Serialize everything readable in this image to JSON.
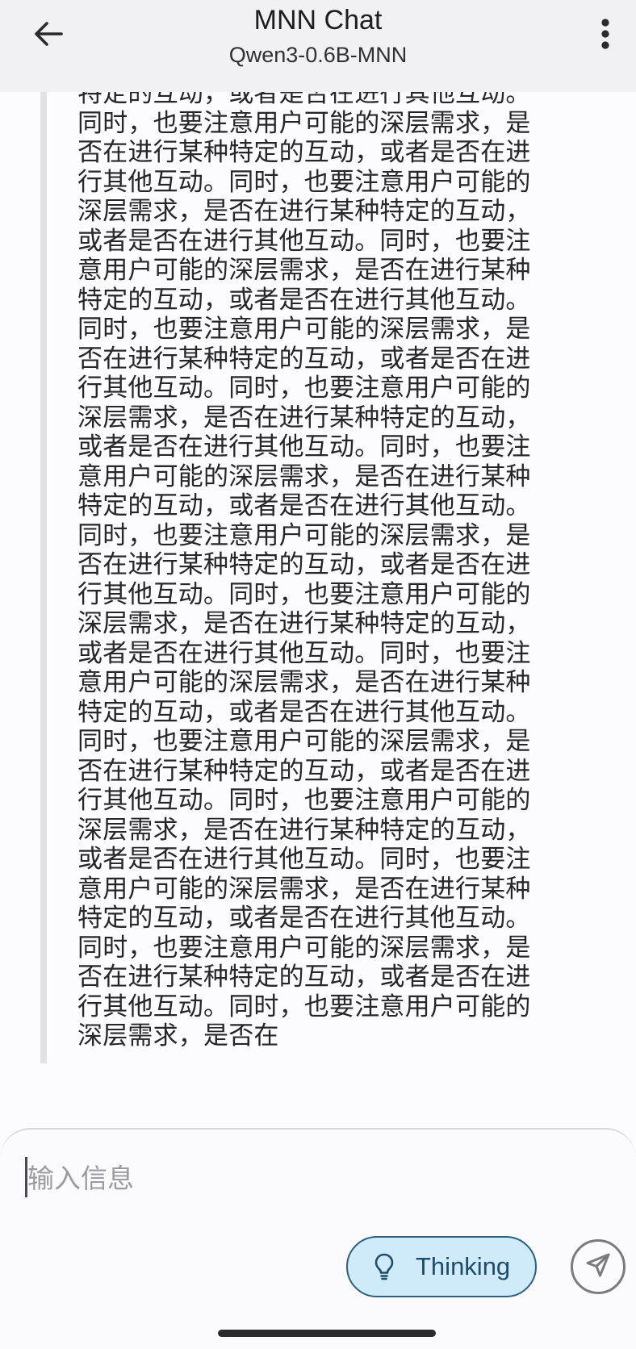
{
  "header": {
    "title": "MNN Chat",
    "subtitle": "Qwen3-0.6B-MNN",
    "back_icon": "arrow-left-icon",
    "menu_icon": "more-vertical-icon"
  },
  "message": {
    "lines": [
      "特定的互动，或者是否在进行其他互动。",
      "同时，也要注意用户可能的深层需求，是",
      "否在进行某种特定的互动，或者是否在进",
      "行其他互动。同时，也要注意用户可能的",
      "深层需求，是否在进行某种特定的互动，",
      "或者是否在进行其他互动。同时，也要注",
      "意用户可能的深层需求，是否在进行某种",
      "特定的互动，或者是否在进行其他互动。",
      "同时，也要注意用户可能的深层需求，是",
      "否在进行某种特定的互动，或者是否在进",
      "行其他互动。同时，也要注意用户可能的",
      "深层需求，是否在进行某种特定的互动，",
      "或者是否在进行其他互动。同时，也要注",
      "意用户可能的深层需求，是否在进行某种",
      "特定的互动，或者是否在进行其他互动。",
      "同时，也要注意用户可能的深层需求，是",
      "否在进行某种特定的互动，或者是否在进",
      "行其他互动。同时，也要注意用户可能的",
      "深层需求，是否在进行某种特定的互动，",
      "或者是否在进行其他互动。同时，也要注",
      "意用户可能的深层需求，是否在进行某种",
      "特定的互动，或者是否在进行其他互动。",
      "同时，也要注意用户可能的深层需求，是",
      "否在进行某种特定的互动，或者是否在进",
      "行其他互动。同时，也要注意用户可能的",
      "深层需求，是否在进行某种特定的互动，",
      "或者是否在进行其他互动。同时，也要注",
      "意用户可能的深层需求，是否在进行某种",
      "特定的互动，或者是否在进行其他互动。",
      "同时，也要注意用户可能的深层需求，是",
      "否在进行某种特定的互动，或者是否在进",
      "行其他互动。同时，也要注意用户可能的",
      "深层需求，是否在"
    ]
  },
  "input": {
    "placeholder": "输入信息",
    "value": ""
  },
  "actions": {
    "thinking_label": "Thinking",
    "thinking_icon": "lightbulb-icon",
    "send_icon": "send-icon"
  },
  "colors": {
    "header_bg": "#f1f1f3",
    "thinking_bg": "#cfeaf8",
    "thinking_border": "#2c5f80",
    "quote_bar": "#e2e2e6"
  }
}
